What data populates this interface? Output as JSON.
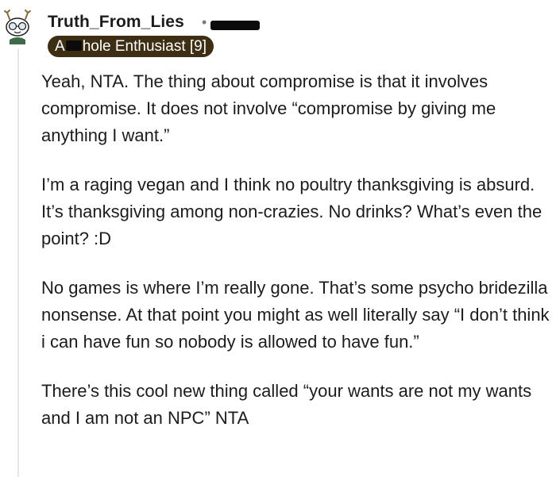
{
  "post": {
    "username": "Truth_From_Lies",
    "separator": "•",
    "flair_prefix": "A",
    "flair_suffix": "hole Enthusiast [9]",
    "avatar_icon": "snoo-reindeer-avatar-icon"
  },
  "comment": {
    "paragraphs": [
      "Yeah, NTA. The thing about compromise is that it involves compromise. It does not involve “compromise by giving me anything I want.”",
      "I’m a raging vegan and I think no poultry thanksgiving is absurd. It’s thanksgiving among non-crazies. No drinks? What’s even the point? :D",
      "No games is where I’m really gone. That’s some psycho bridezilla nonsense. At that point you might as well literally say “I don’t think i can have fun so nobody is allowed to have fun.”",
      "There’s this cool new thing called “your wants are not my wants and I am not an NPC” NTA"
    ]
  },
  "colors": {
    "flair_bg": "#3d2e14",
    "text": "#1c1c1c",
    "thread_line": "#e6e6e6"
  }
}
